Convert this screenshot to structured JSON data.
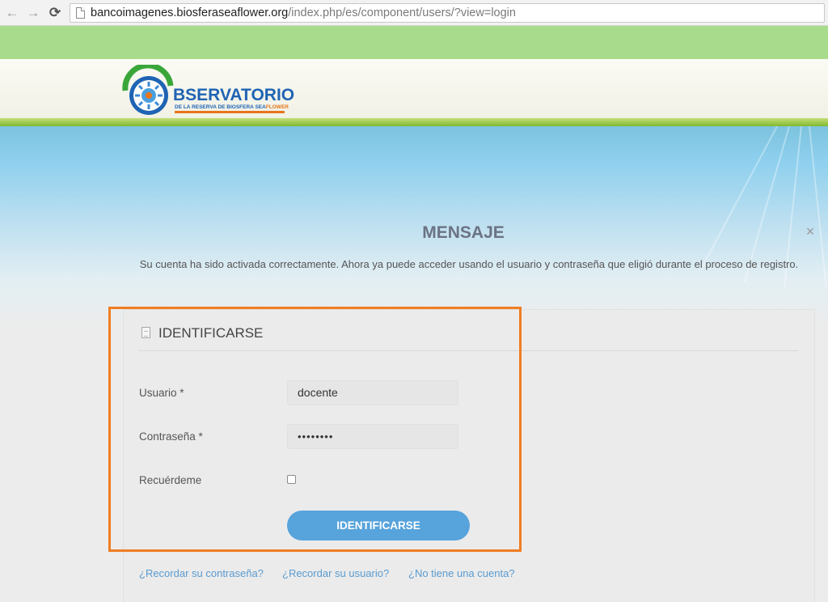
{
  "browser": {
    "url_host": "bancoimagenes.biosferaseaflower.org",
    "url_path": "/index.php/es/component/users/?view=login"
  },
  "header": {
    "logo_title": "BSERVATORIO",
    "logo_subtitle_main": "DE LA RESERVA DE BIOSFERA SEA",
    "logo_subtitle_accent": "FLOWER"
  },
  "message": {
    "title": "MENSAJE",
    "close": "×",
    "text": "Su cuenta ha sido activada correctamente. Ahora ya puede acceder usando el usuario y contraseña que eligió durante el proceso de registro."
  },
  "login": {
    "title": "IDENTIFICARSE",
    "username_label": "Usuario *",
    "username_value": "docente",
    "password_label": "Contraseña *",
    "password_value": "••••••••",
    "remember_label": "Recuérdeme",
    "remember_checked": false,
    "submit_label": "IDENTIFICARSE"
  },
  "links": {
    "forgot_password": "¿Recordar su contraseña?",
    "forgot_username": "¿Recordar su usuario?",
    "register": "¿No tiene una cuenta?"
  },
  "colors": {
    "highlight": "#f07d22",
    "button": "#57a3dc",
    "link": "#5a9bd0",
    "logo_blue": "#1f63b3"
  },
  "icons": {
    "back": "arrow-left",
    "forward": "arrow-right",
    "reload": "reload",
    "page": "document",
    "close": "close"
  }
}
